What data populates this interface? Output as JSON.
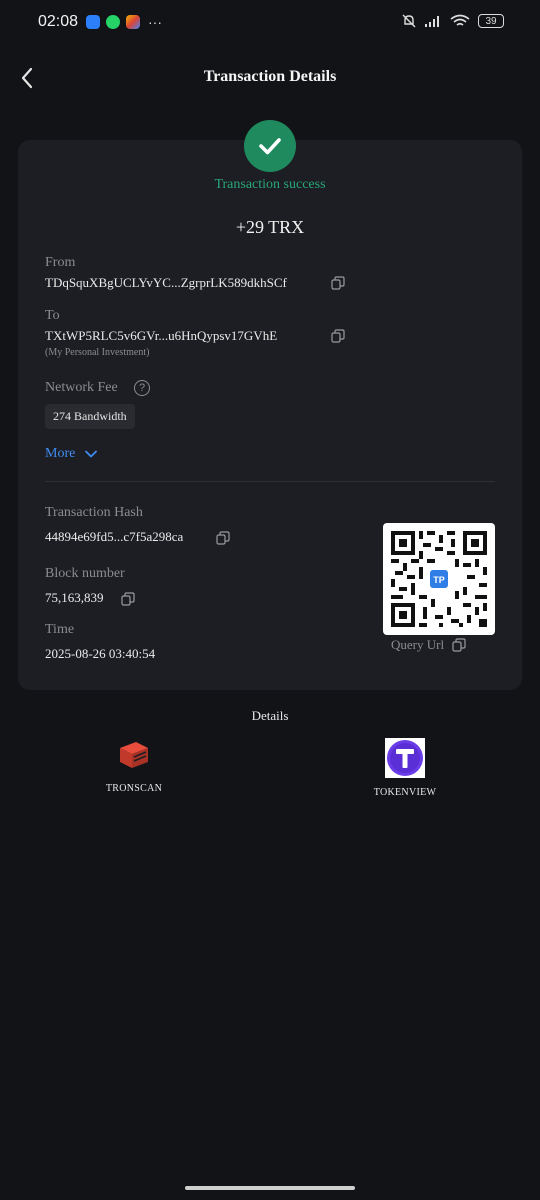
{
  "status_bar": {
    "time": "02:08",
    "battery": "39"
  },
  "header": {
    "title": "Transaction Details"
  },
  "transaction": {
    "status": "Transaction success",
    "amount": "+29 TRX",
    "from_label": "From",
    "from_address": "TDqSquXBgUCLYvYC...ZgrprLK589dkhSCf",
    "to_label": "To",
    "to_address": "TXtWP5RLC5v6GVr...u6HnQypsv17GVhE",
    "to_note": "(My Personal Investment)",
    "fee_label": "Network Fee",
    "fee_value": "274 Bandwidth",
    "more_label": "More",
    "hash_label": "Transaction Hash",
    "hash_value": "44894e69fd5...c7f5a298ca",
    "block_label": "Block number",
    "block_value": "75,163,839",
    "time_label": "Time",
    "time_value": "2025-08-26 03:40:54",
    "qr_badge": "TP",
    "query_url_label": "Query Url"
  },
  "details": {
    "title": "Details",
    "explorers": [
      {
        "name": "TRONSCAN",
        "icon": "tronscan-icon"
      },
      {
        "name": "TOKENVIEW",
        "icon": "tokenview-icon"
      }
    ]
  },
  "colors": {
    "accent_success": "#1e8a5e",
    "link": "#3f8cf2",
    "background": "#121316",
    "card": "#1d1e23"
  }
}
